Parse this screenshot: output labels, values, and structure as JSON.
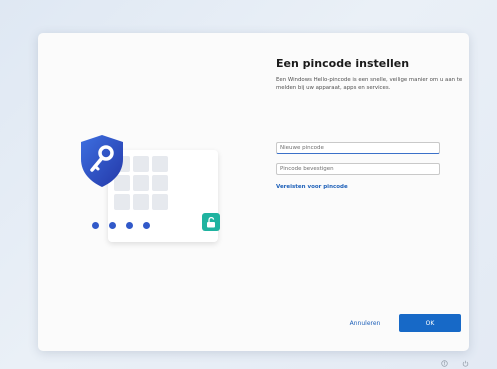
{
  "dialog": {
    "title": "Een pincode instellen",
    "description": "Een Windows Hello-pincode is een snelle, veilige manier om u aan te melden bij uw apparaat, apps en services."
  },
  "form": {
    "new_pin_placeholder": "Nieuwe pincode",
    "confirm_pin_placeholder": "Pincode bevestigen",
    "requirements_link": "Vereisten voor pincode"
  },
  "buttons": {
    "cancel_label": "Annuleren",
    "ok_label": "OK"
  },
  "colors": {
    "accent": "#1769c7",
    "shield": "#2f4fc4",
    "lock": "#1fb3a0"
  },
  "icons": {
    "illustration_shield": "shield-key-icon",
    "illustration_lock": "unlocked-padlock-icon",
    "tray_left": "accessibility-icon",
    "tray_right": "power-icon"
  }
}
